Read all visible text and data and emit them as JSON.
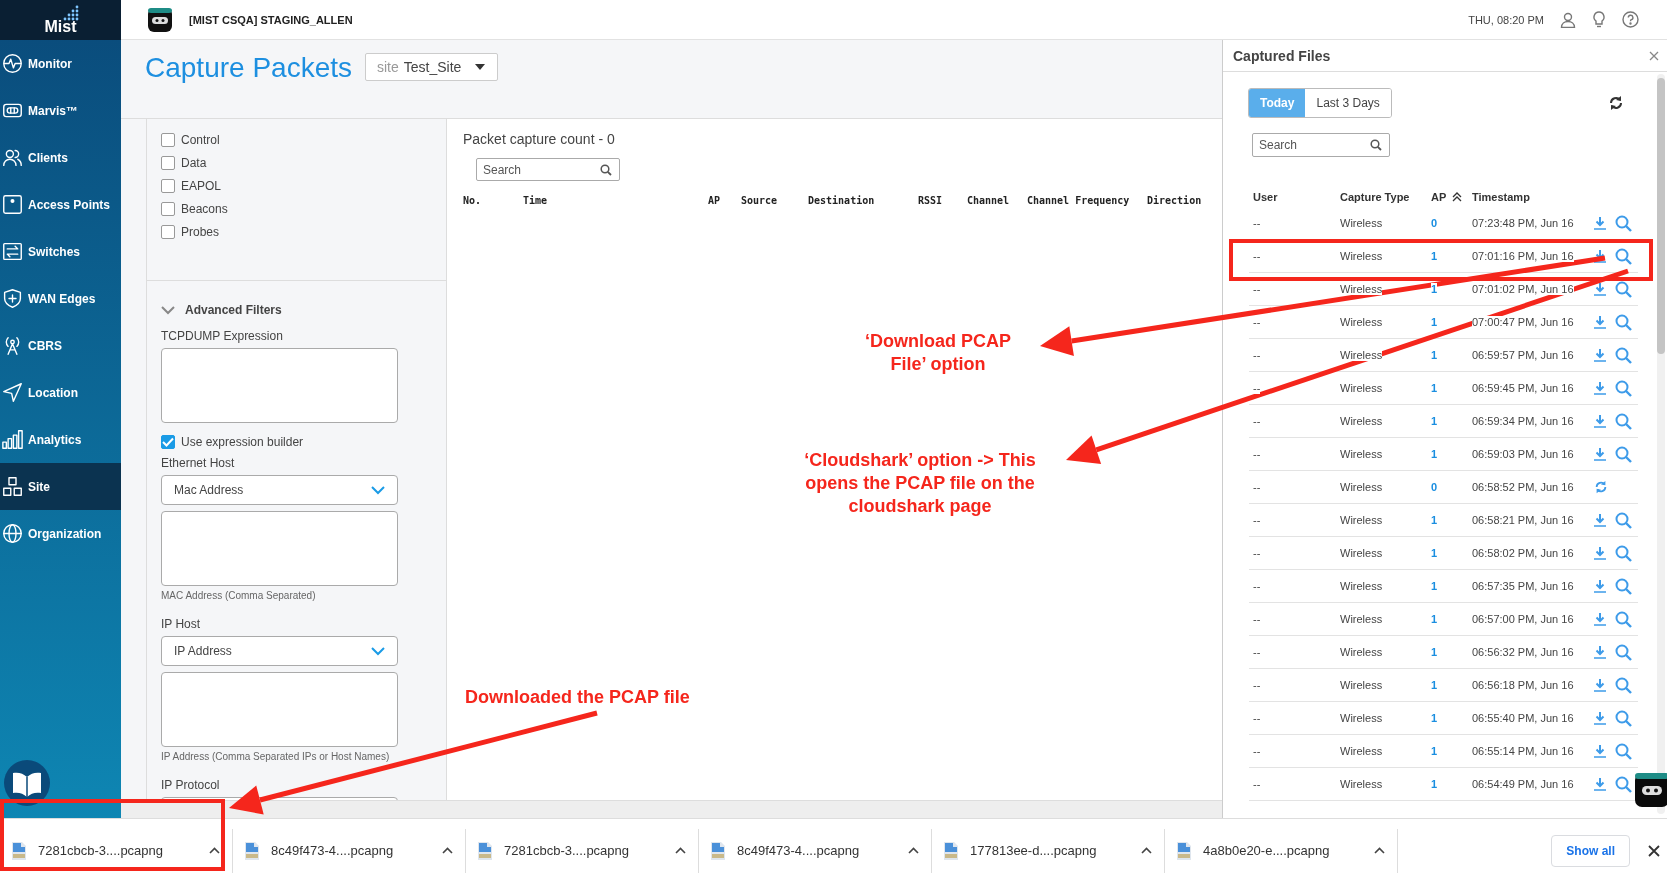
{
  "sidebar": {
    "logo": "Mist",
    "items": [
      {
        "label": "Monitor",
        "selected": false
      },
      {
        "label": "Marvis™",
        "selected": false
      },
      {
        "label": "Clients",
        "selected": false
      },
      {
        "label": "Access Points",
        "selected": false
      },
      {
        "label": "Switches",
        "selected": false
      },
      {
        "label": "WAN Edges",
        "selected": false
      },
      {
        "label": "CBRS",
        "selected": false
      },
      {
        "label": "Location",
        "selected": false
      },
      {
        "label": "Analytics",
        "selected": false
      },
      {
        "label": "Site",
        "selected": true
      },
      {
        "label": "Organization",
        "selected": false
      }
    ]
  },
  "topbar": {
    "org_title": "[MIST CSQA] STAGING_ALLEN",
    "datetime": "THU, 08:20 PM"
  },
  "page": {
    "title": "Capture Packets",
    "site_selector": {
      "prefix": "site",
      "value": "Test_Site"
    }
  },
  "filters": {
    "checkboxes": [
      {
        "label": "Control",
        "checked": false
      },
      {
        "label": "Data",
        "checked": false
      },
      {
        "label": "EAPOL",
        "checked": false
      },
      {
        "label": "Beacons",
        "checked": false
      },
      {
        "label": "Probes",
        "checked": false
      }
    ],
    "advanced": {
      "title": "Advanced Filters",
      "expanded": true,
      "tcpdump_label": "TCPDUMP Expression",
      "builder": {
        "label": "Use expression builder",
        "checked": true
      },
      "ethernet_host": {
        "label": "Ethernet Host",
        "select": "Mac Address",
        "hint": "MAC Address (Comma Separated)"
      },
      "ip_host": {
        "label": "IP Host",
        "select": "IP Address",
        "hint": "IP Address (Comma Separated IPs or Host Names)"
      },
      "ip_protocol_label": "IP Protocol"
    }
  },
  "packets": {
    "count": "Packet capture count - 0",
    "search": {
      "placeholder": "Search"
    },
    "columns": [
      "No.",
      "Time",
      "AP",
      "Source",
      "Destination",
      "RSSI",
      "Channel",
      "Channel Frequency",
      "Direction"
    ]
  },
  "captured_files": {
    "title": "Captured Files",
    "tabs": [
      {
        "label": "Today",
        "selected": true
      },
      {
        "label": "Last 3 Days",
        "selected": false
      }
    ],
    "search": {
      "placeholder": "Search"
    },
    "columns": [
      "User",
      "Capture Type",
      "AP",
      "Timestamp"
    ],
    "rows": [
      {
        "user": "--",
        "type": "Wireless",
        "ap": "0",
        "timestamp": "07:23:48 PM, Jun 16",
        "kind": "ready"
      },
      {
        "user": "--",
        "type": "Wireless",
        "ap": "1",
        "timestamp": "07:01:16 PM, Jun 16",
        "kind": "ready"
      },
      {
        "user": "--",
        "type": "Wireless",
        "ap": "1",
        "timestamp": "07:01:02 PM, Jun 16",
        "kind": "ready"
      },
      {
        "user": "--",
        "type": "Wireless",
        "ap": "1",
        "timestamp": "07:00:47 PM, Jun 16",
        "kind": "ready"
      },
      {
        "user": "--",
        "type": "Wireless",
        "ap": "1",
        "timestamp": "06:59:57 PM, Jun 16",
        "kind": "ready"
      },
      {
        "user": "--",
        "type": "Wireless",
        "ap": "1",
        "timestamp": "06:59:45 PM, Jun 16",
        "kind": "ready"
      },
      {
        "user": "--",
        "type": "Wireless",
        "ap": "1",
        "timestamp": "06:59:34 PM, Jun 16",
        "kind": "ready"
      },
      {
        "user": "--",
        "type": "Wireless",
        "ap": "1",
        "timestamp": "06:59:03 PM, Jun 16",
        "kind": "ready"
      },
      {
        "user": "--",
        "type": "Wireless",
        "ap": "0",
        "timestamp": "06:58:52 PM, Jun 16",
        "kind": "processing"
      },
      {
        "user": "--",
        "type": "Wireless",
        "ap": "1",
        "timestamp": "06:58:21 PM, Jun 16",
        "kind": "ready"
      },
      {
        "user": "--",
        "type": "Wireless",
        "ap": "1",
        "timestamp": "06:58:02 PM, Jun 16",
        "kind": "ready"
      },
      {
        "user": "--",
        "type": "Wireless",
        "ap": "1",
        "timestamp": "06:57:35 PM, Jun 16",
        "kind": "ready"
      },
      {
        "user": "--",
        "type": "Wireless",
        "ap": "1",
        "timestamp": "06:57:00 PM, Jun 16",
        "kind": "ready"
      },
      {
        "user": "--",
        "type": "Wireless",
        "ap": "1",
        "timestamp": "06:56:32 PM, Jun 16",
        "kind": "ready"
      },
      {
        "user": "--",
        "type": "Wireless",
        "ap": "1",
        "timestamp": "06:56:18 PM, Jun 16",
        "kind": "ready"
      },
      {
        "user": "--",
        "type": "Wireless",
        "ap": "1",
        "timestamp": "06:55:40 PM, Jun 16",
        "kind": "ready"
      },
      {
        "user": "--",
        "type": "Wireless",
        "ap": "1",
        "timestamp": "06:55:14 PM, Jun 16",
        "kind": "ready"
      },
      {
        "user": "--",
        "type": "Wireless",
        "ap": "1",
        "timestamp": "06:54:49 PM, Jun 16",
        "kind": "ready"
      }
    ]
  },
  "downloads": {
    "files": [
      "7281cbcb-3....pcapng",
      "8c49f473-4....pcapng",
      "7281cbcb-3....pcapng",
      "8c49f473-4....pcapng",
      "177813ee-d....pcapng",
      "4a8b0e20-e....pcapng"
    ],
    "show_all": "Show all"
  },
  "annotations": {
    "callouts": [
      "‘Download PCAP File’ option",
      "‘Cloudshark’ option -> This opens the PCAP file on the cloudshark page",
      "Downloaded the PCAP file"
    ]
  }
}
